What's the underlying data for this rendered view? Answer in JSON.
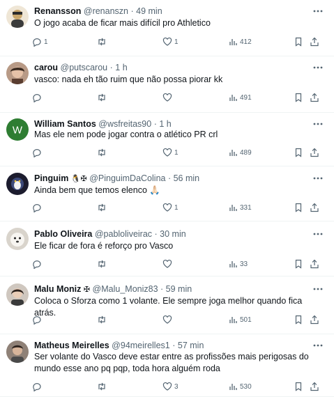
{
  "tweets": [
    {
      "name": "Renansson",
      "handle": "@renanszn",
      "time": "49 min",
      "emojis": "",
      "text": "O jogo acaba de ficar mais difícil pro Athletico",
      "replies": "1",
      "retweets": "",
      "likes": "1",
      "views": "412",
      "avatar_color": "#c9a66b"
    },
    {
      "name": "carou",
      "handle": "@putscarou",
      "time": "1 h",
      "emojis": "",
      "text": "vasco: nada eh tão ruim que não possa piorar kk",
      "replies": "",
      "retweets": "",
      "likes": "",
      "views": "491",
      "avatar_color": "#7a5a48"
    },
    {
      "name": "William Santos",
      "handle": "@wsfreitas90",
      "time": "1 h",
      "emojis": "",
      "text": "Mas ele nem pode jogar contra o atlético PR crl",
      "replies": "",
      "retweets": "",
      "likes": "1",
      "views": "489",
      "avatar_color": "#2e7d32",
      "avatar_letter": "W"
    },
    {
      "name": "Pinguim",
      "handle": "@PinguimDaColina",
      "time": "56 min",
      "emojis": "🐧✠",
      "text": "Ainda bem que temos elenco 🙏🏻",
      "replies": "",
      "retweets": "",
      "likes": "1",
      "views": "331",
      "avatar_color": "#1c1c2e"
    },
    {
      "name": "Pablo Oliveira",
      "handle": "@pabloliveirac",
      "time": "30 min",
      "emojis": "",
      "text": "Ele ficar de fora é reforço pro Vasco",
      "replies": "",
      "retweets": "",
      "likes": "",
      "views": "33",
      "avatar_color": "#e8e4de"
    },
    {
      "name": "Malu Moniz",
      "handle": "@Malu_Moniz83",
      "time": "59 min",
      "emojis": "✠",
      "text": "Coloca o Sforza como 1 volante. Ele sempre joga melhor quando fica atrás.",
      "replies": "",
      "retweets": "",
      "likes": "",
      "views": "501",
      "avatar_color": "#9a8c82"
    },
    {
      "name": "Matheus Meirelles",
      "handle": "@94meirelles1",
      "time": "57 min",
      "emojis": "",
      "text": "Ser volante do Vasco deve estar entre as profissões mais perigosas do mundo esse ano pq pqp, toda hora alguém roda",
      "replies": "",
      "retweets": "",
      "likes": "3",
      "views": "530",
      "avatar_color": "#6e5a4e"
    }
  ]
}
